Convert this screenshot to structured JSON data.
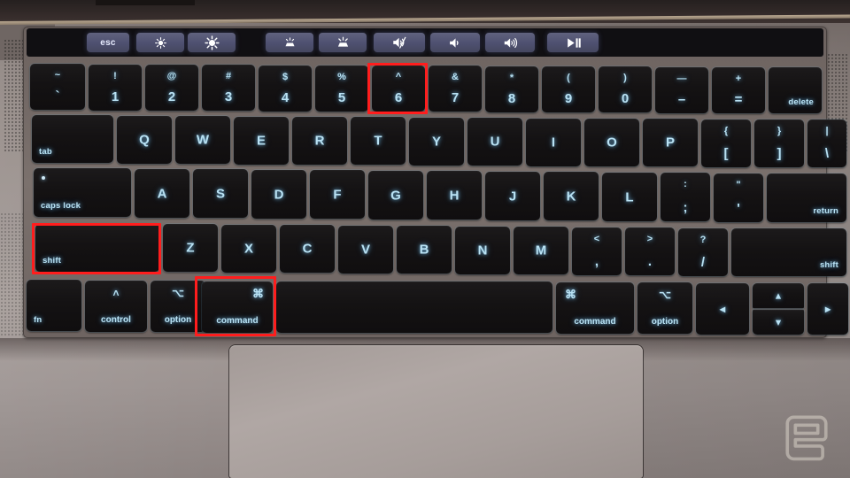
{
  "scene": {
    "device": "MacBook Pro keyboard with Touch Bar",
    "watermark": "engadget-e-logo",
    "accent_highlight_color": "#ff1d1d",
    "key_legend_color": "#b9e2f4",
    "touchbar_button_color": "#4e5070"
  },
  "touchbar": {
    "buttons": [
      {
        "name": "esc-key",
        "label": "esc",
        "icon": ""
      },
      {
        "name": "brightness-down-button",
        "label": "",
        "icon": "brightness-down-icon"
      },
      {
        "name": "brightness-up-button",
        "label": "",
        "icon": "brightness-up-icon"
      },
      {
        "name": "keyboard-backlight-down-button",
        "label": "",
        "icon": "keyboard-backlight-down-icon"
      },
      {
        "name": "keyboard-backlight-up-button",
        "label": "",
        "icon": "keyboard-backlight-up-icon"
      },
      {
        "name": "mute-button",
        "label": "",
        "icon": "mute-icon"
      },
      {
        "name": "volume-down-button",
        "label": "",
        "icon": "volume-down-icon"
      },
      {
        "name": "volume-up-button",
        "label": "",
        "icon": "volume-up-icon"
      },
      {
        "name": "play-pause-button",
        "label": "",
        "icon": "play-pause-icon"
      }
    ]
  },
  "keyboard": {
    "number_row": [
      {
        "name": "key-tilde",
        "top": "~",
        "bottom": "`"
      },
      {
        "name": "key-1",
        "top": "!",
        "bottom": "1"
      },
      {
        "name": "key-2",
        "top": "@",
        "bottom": "2"
      },
      {
        "name": "key-3",
        "top": "#",
        "bottom": "3"
      },
      {
        "name": "key-4",
        "top": "$",
        "bottom": "4"
      },
      {
        "name": "key-5",
        "top": "%",
        "bottom": "5"
      },
      {
        "name": "key-6",
        "top": "^",
        "bottom": "6",
        "highlighted": true
      },
      {
        "name": "key-7",
        "top": "&",
        "bottom": "7"
      },
      {
        "name": "key-8",
        "top": "*",
        "bottom": "8"
      },
      {
        "name": "key-9",
        "top": "(",
        "bottom": "9"
      },
      {
        "name": "key-0",
        "top": ")",
        "bottom": "0"
      },
      {
        "name": "key-minus",
        "top": "—",
        "bottom": "–"
      },
      {
        "name": "key-equals",
        "top": "+",
        "bottom": "="
      },
      {
        "name": "key-delete",
        "label": "delete"
      }
    ],
    "top_row": [
      {
        "name": "key-tab",
        "label": "tab"
      },
      {
        "name": "key-q",
        "label": "Q"
      },
      {
        "name": "key-w",
        "label": "W"
      },
      {
        "name": "key-e",
        "label": "E"
      },
      {
        "name": "key-r",
        "label": "R"
      },
      {
        "name": "key-t",
        "label": "T"
      },
      {
        "name": "key-y",
        "label": "Y"
      },
      {
        "name": "key-u",
        "label": "U"
      },
      {
        "name": "key-i",
        "label": "I"
      },
      {
        "name": "key-o",
        "label": "O"
      },
      {
        "name": "key-p",
        "label": "P"
      },
      {
        "name": "key-bracket-left",
        "top": "{",
        "bottom": "["
      },
      {
        "name": "key-bracket-right",
        "top": "}",
        "bottom": "]"
      },
      {
        "name": "key-backslash",
        "top": "|",
        "bottom": "\\"
      }
    ],
    "home_row": [
      {
        "name": "key-caps-lock",
        "label": "caps lock",
        "led": true
      },
      {
        "name": "key-a",
        "label": "A"
      },
      {
        "name": "key-s",
        "label": "S"
      },
      {
        "name": "key-d",
        "label": "D"
      },
      {
        "name": "key-f",
        "label": "F"
      },
      {
        "name": "key-g",
        "label": "G"
      },
      {
        "name": "key-h",
        "label": "H"
      },
      {
        "name": "key-j",
        "label": "J"
      },
      {
        "name": "key-k",
        "label": "K"
      },
      {
        "name": "key-l",
        "label": "L"
      },
      {
        "name": "key-semicolon",
        "top": ":",
        "bottom": ";"
      },
      {
        "name": "key-quote",
        "top": "\"",
        "bottom": "'"
      },
      {
        "name": "key-return",
        "label": "return"
      }
    ],
    "bottom_row": [
      {
        "name": "key-shift-left",
        "label": "shift",
        "highlighted": true
      },
      {
        "name": "key-z",
        "label": "Z"
      },
      {
        "name": "key-x",
        "label": "X"
      },
      {
        "name": "key-c",
        "label": "C"
      },
      {
        "name": "key-v",
        "label": "V"
      },
      {
        "name": "key-b",
        "label": "B"
      },
      {
        "name": "key-n",
        "label": "N"
      },
      {
        "name": "key-m",
        "label": "M"
      },
      {
        "name": "key-comma",
        "top": "<",
        "bottom": ","
      },
      {
        "name": "key-period",
        "top": ">",
        "bottom": "."
      },
      {
        "name": "key-slash",
        "top": "?",
        "bottom": "/"
      },
      {
        "name": "key-shift-right",
        "label": "shift"
      }
    ],
    "modifier_row": [
      {
        "name": "key-fn",
        "label": "fn",
        "symbol": ""
      },
      {
        "name": "key-control",
        "label": "control",
        "symbol": "˄"
      },
      {
        "name": "key-option-left",
        "label": "option",
        "symbol": "⌥"
      },
      {
        "name": "key-command-left",
        "label": "command",
        "symbol": "⌘",
        "highlighted": true
      },
      {
        "name": "key-space",
        "label": "",
        "symbol": ""
      },
      {
        "name": "key-command-right",
        "label": "command",
        "symbol": "⌘"
      },
      {
        "name": "key-option-right",
        "label": "option",
        "symbol": "⌥"
      },
      {
        "name": "key-arrow-left",
        "label": "",
        "symbol": "◂"
      },
      {
        "name": "key-arrow-up",
        "label": "",
        "symbol": "▴"
      },
      {
        "name": "key-arrow-down",
        "label": "",
        "symbol": "▾"
      },
      {
        "name": "key-arrow-right",
        "label": "",
        "symbol": "▸"
      }
    ]
  },
  "highlights": [
    {
      "name": "highlight-key-6",
      "target": "key-6"
    },
    {
      "name": "highlight-key-shift",
      "target": "key-shift-left"
    },
    {
      "name": "highlight-key-command",
      "target": "key-command-left"
    }
  ]
}
